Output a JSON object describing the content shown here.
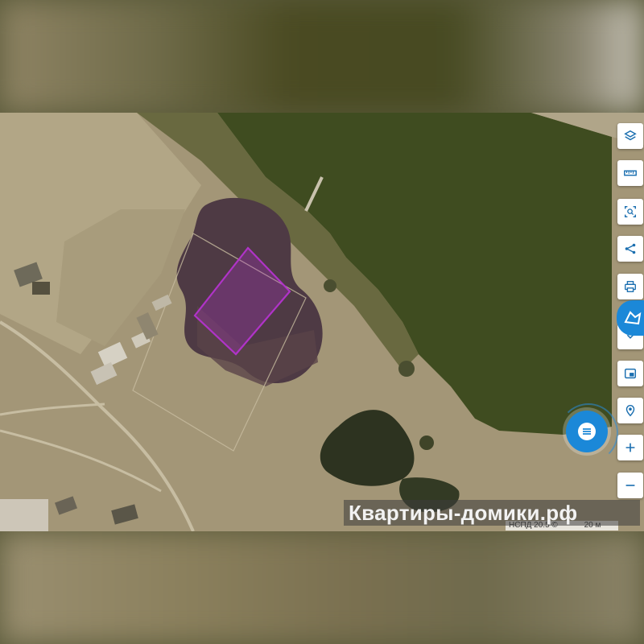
{
  "map": {
    "watermark_text": "Квартиры-домики.рф",
    "attribution_text": "НСПД 20.5 ©",
    "scale_text": "20 м",
    "plot_outline_color": "#b033c8"
  },
  "toolbar": [
    {
      "name": "layers",
      "icon": "layers-icon"
    },
    {
      "name": "ruler",
      "icon": "ruler-icon"
    },
    {
      "name": "select-area",
      "icon": "select-area-icon"
    },
    {
      "name": "share",
      "icon": "share-icon"
    },
    {
      "name": "print",
      "icon": "print-icon"
    },
    {
      "name": "info",
      "icon": "chevron-down-icon"
    },
    {
      "name": "minimap",
      "icon": "minimap-icon"
    },
    {
      "name": "location",
      "icon": "location-icon"
    },
    {
      "name": "zoom-in",
      "icon": "plus-icon"
    },
    {
      "name": "zoom-out",
      "icon": "minus-icon"
    }
  ],
  "colors": {
    "accent": "#1b88d8",
    "water": "#3d4a1e",
    "field": "#9c9072"
  }
}
